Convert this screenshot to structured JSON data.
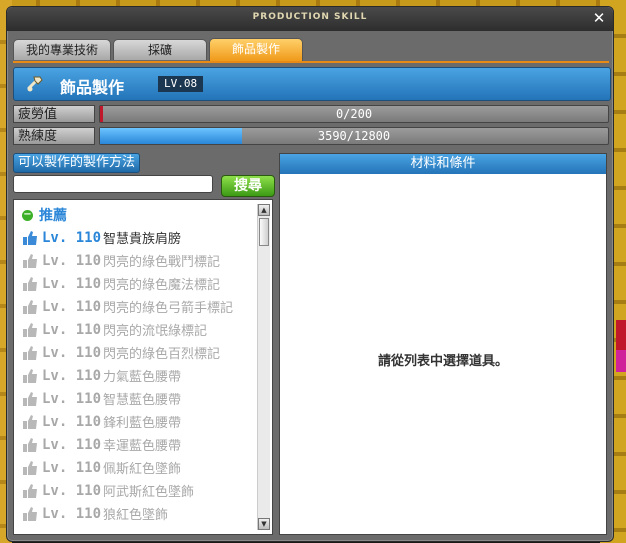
{
  "window": {
    "title": "PRODUCTION SKILL"
  },
  "tabs": [
    {
      "label": "我的專業技術",
      "active": false
    },
    {
      "label": "採礦",
      "active": false
    },
    {
      "label": "飾品製作",
      "active": true
    }
  ],
  "header": {
    "skill_name": "飾品製作",
    "level": "LV.08",
    "icon": "hammer-icon"
  },
  "stats": [
    {
      "label": "疲勞值",
      "value": "0/200",
      "fraction": 0.0
    },
    {
      "label": "熟練度",
      "value": "3590/12800",
      "fraction": 0.2805
    }
  ],
  "recipes": {
    "title": "可以製作的製作方法",
    "search_button": "搜尋",
    "search_value": "",
    "category": "推薦",
    "items": [
      {
        "level": "Lv. 110",
        "name": "智慧貴族肩膀",
        "available": true
      },
      {
        "level": "Lv. 110",
        "name": "閃亮的綠色戰鬥標記",
        "available": false
      },
      {
        "level": "Lv. 110",
        "name": "閃亮的綠色魔法標記",
        "available": false
      },
      {
        "level": "Lv. 110",
        "name": "閃亮的綠色弓箭手標記",
        "available": false
      },
      {
        "level": "Lv. 110",
        "name": "閃亮的流氓綠標記",
        "available": false
      },
      {
        "level": "Lv. 110",
        "name": "閃亮的綠色百烈標記",
        "available": false
      },
      {
        "level": "Lv. 110",
        "name": "力氣藍色腰帶",
        "available": false
      },
      {
        "level": "Lv. 110",
        "name": "智慧藍色腰帶",
        "available": false
      },
      {
        "level": "Lv. 110",
        "name": "鋒利藍色腰帶",
        "available": false
      },
      {
        "level": "Lv. 110",
        "name": "幸運藍色腰帶",
        "available": false
      },
      {
        "level": "Lv. 110",
        "name": "佩斯紅色墜飾",
        "available": false
      },
      {
        "level": "Lv. 110",
        "name": "阿武斯紅色墜飾",
        "available": false
      },
      {
        "level": "Lv. 110",
        "name": "狼紅色墜飾",
        "available": false
      }
    ]
  },
  "materials": {
    "title": "材料和條件",
    "empty_message": "請從列表中選擇道具。"
  },
  "colors": {
    "accent_blue": "#2a86d8",
    "tab_active": "#f09a1a",
    "fatigue_fill": "#c0182a",
    "mastery_fill": "#3aa2ea",
    "search_green": "#3c9a14"
  }
}
